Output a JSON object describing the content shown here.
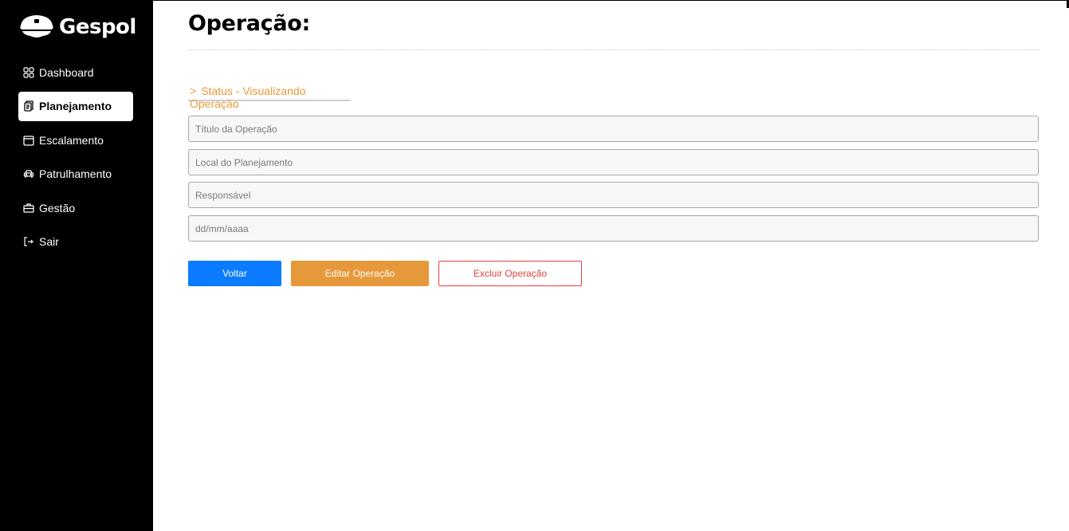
{
  "brand": {
    "name": "Gespol"
  },
  "sidebar": {
    "items": [
      {
        "label": "Dashboard",
        "icon": "grid-icon",
        "active": false
      },
      {
        "label": "Planejamento",
        "icon": "clipboard-icon",
        "active": true
      },
      {
        "label": "Escalamento",
        "icon": "calendar-icon",
        "active": false
      },
      {
        "label": "Patrulhamento",
        "icon": "car-icon",
        "active": false
      },
      {
        "label": "Gestão",
        "icon": "briefcase-icon",
        "active": false
      },
      {
        "label": "Sair",
        "icon": "logout-icon",
        "active": false
      }
    ]
  },
  "page": {
    "title": "Operação:",
    "status": {
      "chevron": ">",
      "text": "Status - Visualizando Operação"
    }
  },
  "form": {
    "titulo": {
      "placeholder": "Título da Operação",
      "value": ""
    },
    "local": {
      "placeholder": "Local do Planejamento",
      "value": ""
    },
    "responsavel": {
      "placeholder": "Responsável",
      "value": ""
    },
    "data": {
      "placeholder": "dd/mm/aaaa",
      "value": ""
    }
  },
  "actions": {
    "back_label": "Voltar",
    "edit_label": "Editar Operação",
    "delete_label": "Excluir Operação"
  },
  "colors": {
    "sidebar_bg": "#000000",
    "accent_orange": "#e5993a",
    "primary_blue": "#0b7cff",
    "danger_red": "#e0413f"
  }
}
